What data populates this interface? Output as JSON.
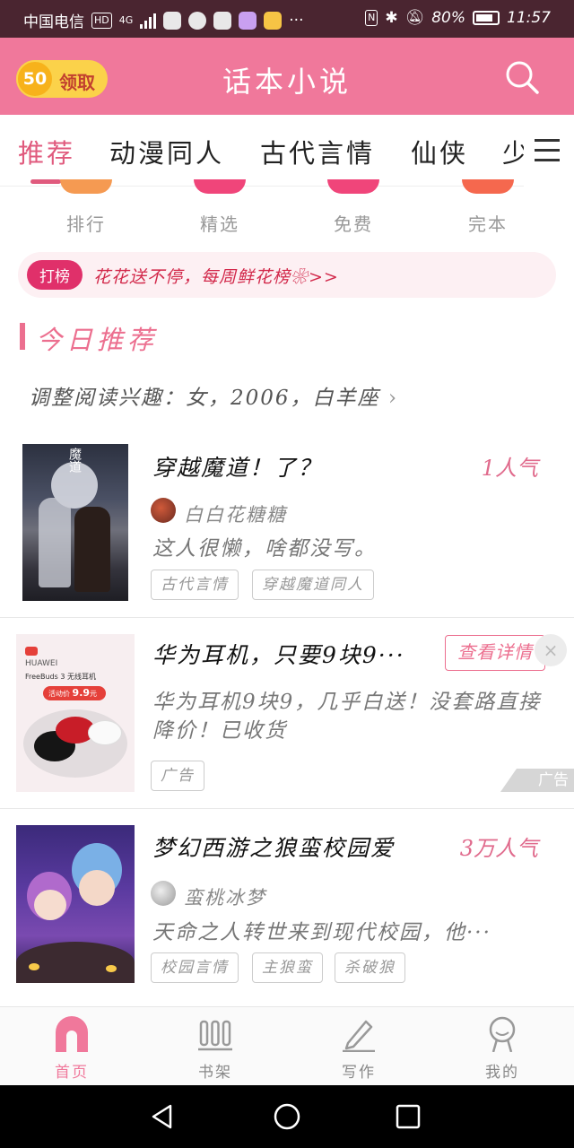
{
  "status_bar": {
    "carrier": "中国电信",
    "hd": "HD",
    "network": "4G",
    "battery": "80%",
    "time": "11:57",
    "more": "···",
    "nfc": "N"
  },
  "header": {
    "coin_value": "50",
    "coin_label": "领取",
    "title": "话本小说",
    "search_icon": "search-icon"
  },
  "tabs": [
    "推荐",
    "动漫同人",
    "古代言情",
    "仙侠",
    "少"
  ],
  "categories": [
    {
      "label": "排行",
      "color": "#f59a52"
    },
    {
      "label": "精选",
      "color": "#f0457a"
    },
    {
      "label": "免费",
      "color": "#f0457a"
    },
    {
      "label": "完本",
      "color": "#f5684e"
    }
  ],
  "banner": {
    "badge": "打榜",
    "text": "花花送不停，每周鲜花榜❀>>"
  },
  "section": {
    "title": "今日推荐",
    "interest": "调整阅读兴趣：女，2006，白羊座"
  },
  "books": [
    {
      "title": "穿越魔道！了？",
      "popularity": "1人气",
      "author": "白白花糖糖",
      "desc": "这人很懒，啥都没写。",
      "tags": [
        "古代言情",
        "穿越魔道同人"
      ],
      "cover_text": "魔道"
    },
    {
      "title": "梦幻西游之狼蛮校园爱",
      "popularity": "3万人气",
      "author": "蛮桃冰梦",
      "desc": "天命之人转世来到现代校园，他···",
      "tags": [
        "校园言情",
        "主狼蛮",
        "杀破狼"
      ]
    }
  ],
  "ad": {
    "title": "华为耳机，只要9块9···",
    "desc_line1": "华为耳机9块9，几乎白送！没套路直接",
    "desc_line2": "降价！已收货",
    "tag": "广告",
    "button": "查看详情",
    "close": "×",
    "mark": "广告",
    "img_brand": "HUAWEI",
    "img_product": "FreeBuds 3 无线耳机",
    "img_price_label": "活动价",
    "img_price": "9.9",
    "img_price_unit": "元"
  },
  "bottom_nav": [
    {
      "label": "首页",
      "icon": "home-icon",
      "active": true
    },
    {
      "label": "书架",
      "icon": "bookshelf-icon",
      "active": false
    },
    {
      "label": "写作",
      "icon": "pencil-icon",
      "active": false
    },
    {
      "label": "我的",
      "icon": "profile-icon",
      "active": false
    }
  ],
  "colors": {
    "accent": "#ec6f8f",
    "header": "#f0789b",
    "status_bar": "#4a2530"
  }
}
